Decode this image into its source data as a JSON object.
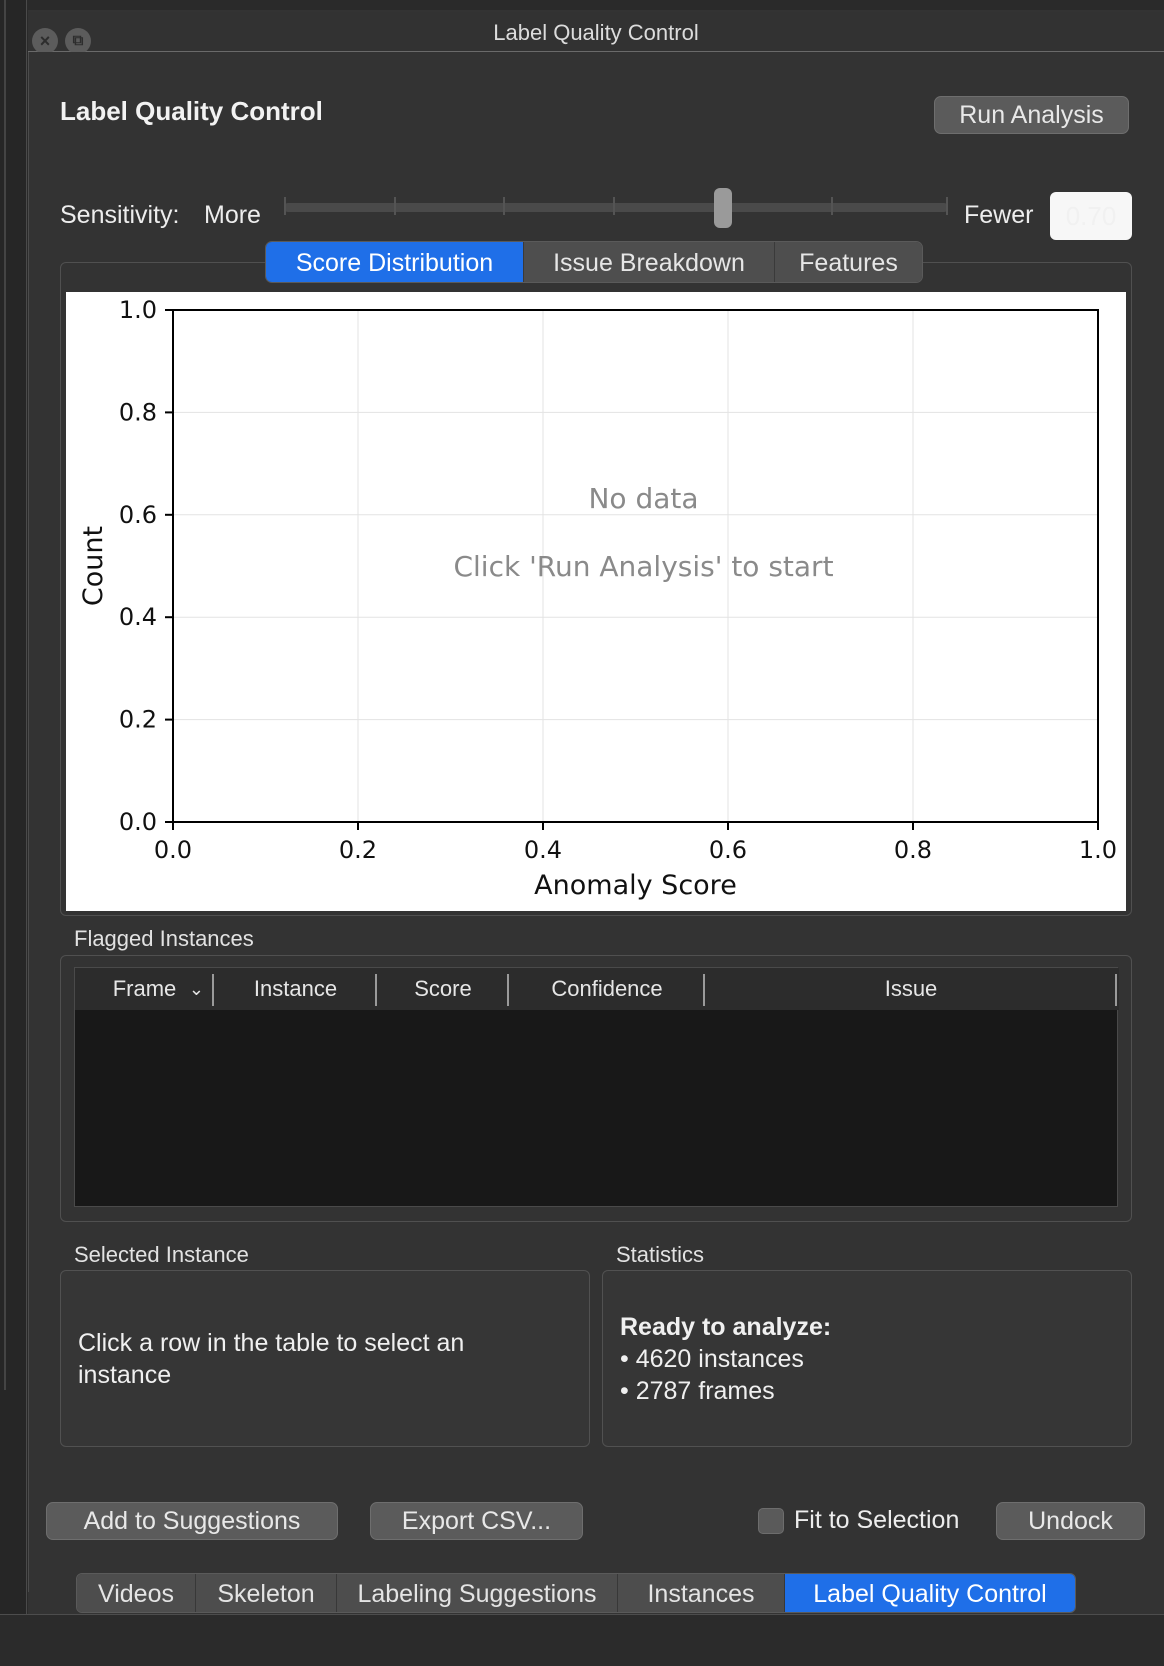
{
  "window": {
    "title": "Label Quality Control"
  },
  "header": {
    "title": "Label Quality Control",
    "run_button": "Run Analysis"
  },
  "sensitivity": {
    "label": "Sensitivity:",
    "min_label": "More",
    "max_label": "Fewer",
    "value": "0.70",
    "level": 0.67
  },
  "tabs": [
    {
      "label": "Score Distribution",
      "active": true
    },
    {
      "label": "Issue Breakdown",
      "active": false
    },
    {
      "label": "Features",
      "active": false
    }
  ],
  "chart_data": {
    "type": "bar",
    "series": [],
    "xlabel": "Anomaly Score",
    "ylabel": "Count",
    "xlim": [
      0.0,
      1.0
    ],
    "ylim": [
      0.0,
      1.0
    ],
    "xticks": [
      "0.0",
      "0.2",
      "0.4",
      "0.6",
      "0.8",
      "1.0"
    ],
    "yticks": [
      "0.0",
      "0.2",
      "0.4",
      "0.6",
      "0.8",
      "1.0"
    ],
    "grid": true,
    "message_line1": "No data",
    "message_line2": "Click 'Run Analysis' to start"
  },
  "flagged": {
    "title": "Flagged Instances",
    "columns": [
      "Frame",
      "Instance",
      "Score",
      "Confidence",
      "Issue"
    ],
    "rows": []
  },
  "selected": {
    "title": "Selected Instance",
    "text": "Click a row in the table to select an instance"
  },
  "statistics": {
    "title": "Statistics",
    "heading": "Ready to analyze:",
    "line1": "• 4620 instances",
    "line2": "• 2787 frames"
  },
  "actions": {
    "add_suggestions": "Add to Suggestions",
    "export_csv": "Export CSV...",
    "fit_selection": "Fit to Selection",
    "undock": "Undock"
  },
  "bottom_tabs": [
    {
      "label": "Videos",
      "active": false
    },
    {
      "label": "Skeleton",
      "active": false
    },
    {
      "label": "Labeling Suggestions",
      "active": false
    },
    {
      "label": "Instances",
      "active": false
    },
    {
      "label": "Label Quality Control",
      "active": true
    }
  ]
}
